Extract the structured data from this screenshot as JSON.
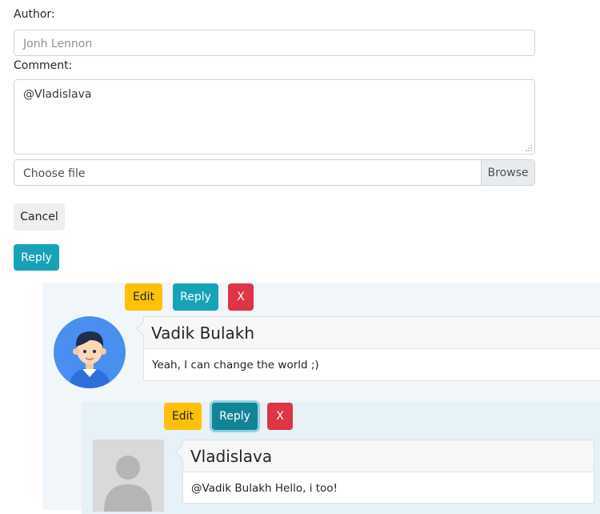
{
  "form": {
    "author_label": "Author:",
    "author_placeholder": "Jonh Lennon",
    "comment_label": "Comment:",
    "comment_value": "@Vladislava",
    "file_label": "Choose file",
    "browse_label": "Browse",
    "cancel_label": "Cancel",
    "reply_label": "Reply"
  },
  "comments": [
    {
      "author": "Vadik Bulakh",
      "text": "Yeah, I can change the world ;)",
      "edit_label": "Edit",
      "reply_label": "Reply",
      "delete_label": "X",
      "avatar": "boy-avatar-icon"
    },
    {
      "author": "Vladislava",
      "text": "@Vadik Bulakh Hello, i too!",
      "edit_label": "Edit",
      "reply_label": "Reply",
      "delete_label": "X",
      "avatar": "default-user-avatar-icon"
    }
  ],
  "colors": {
    "info": "#17a2b8",
    "warning": "#ffc107",
    "danger": "#dc3545",
    "comment_bg": "#f1f6fa",
    "nested_bg": "#e6f1f8"
  }
}
